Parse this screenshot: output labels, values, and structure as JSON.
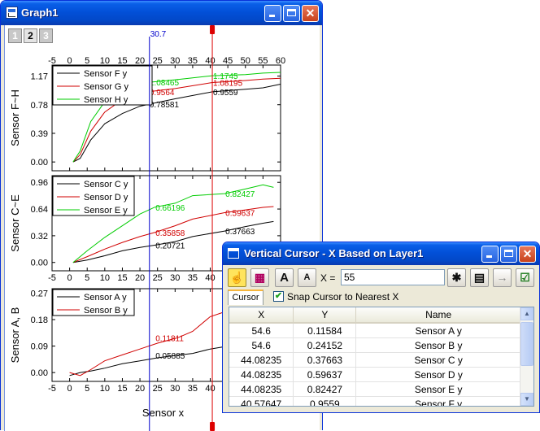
{
  "graph_window": {
    "title": "Graph1",
    "layer_tabs": [
      "1",
      "2",
      "3"
    ],
    "active_layer": "2",
    "cursor_top_label": "30.7"
  },
  "chart_data": [
    {
      "type": "line",
      "layer": "top",
      "ylabel": "Sensor F~H",
      "xlim": [
        -5,
        60
      ],
      "ylim": [
        -0.12,
        1.32
      ],
      "xticks": [
        -5,
        0,
        5,
        10,
        15,
        20,
        25,
        30,
        35,
        40,
        45,
        50,
        55,
        60
      ],
      "yticks": [
        0.0,
        0.39,
        0.78,
        1.17
      ],
      "ytick_labels": [
        "0.00",
        "0.39",
        "0.78",
        "1.17"
      ],
      "legend": "top-left",
      "series": [
        {
          "name": "Sensor F y",
          "color": "#000000",
          "x": [
            1,
            3,
            6,
            10,
            15,
            20,
            22.5,
            30,
            40.58,
            50,
            55,
            60
          ],
          "y": [
            0.0,
            0.05,
            0.3,
            0.52,
            0.66,
            0.76,
            0.78581,
            0.86,
            0.9559,
            0.99,
            1.01,
            1.06
          ]
        },
        {
          "name": "Sensor G y",
          "color": "#d00000",
          "x": [
            1,
            3,
            6,
            10,
            15,
            20,
            22.5,
            30,
            40.58,
            50,
            55,
            60
          ],
          "y": [
            0.0,
            0.1,
            0.42,
            0.68,
            0.85,
            0.93,
            0.9564,
            1.0,
            1.08195,
            1.11,
            1.13,
            1.14
          ]
        },
        {
          "name": "Sensor H y",
          "color": "#00cc00",
          "x": [
            1,
            3,
            6,
            10,
            15,
            20,
            22.5,
            30,
            40.58,
            50,
            55,
            60
          ],
          "y": [
            0.0,
            0.15,
            0.55,
            0.82,
            0.98,
            1.05,
            1.08465,
            1.12,
            1.1745,
            1.19,
            1.21,
            1.22
          ]
        }
      ],
      "annotations": [
        "0.78581",
        "0.9564",
        "1.08465",
        "0.9559",
        "1.08195",
        "1.1745"
      ]
    },
    {
      "type": "line",
      "layer": "middle",
      "ylabel": "Sensor C~E",
      "xlim": [
        -5,
        60
      ],
      "ylim": [
        -0.1,
        1.04
      ],
      "xticks": [
        -5,
        0,
        5,
        10,
        15,
        20,
        25,
        30,
        35,
        40,
        45,
        50,
        55,
        60
      ],
      "yticks": [
        0.0,
        0.32,
        0.64,
        0.96
      ],
      "ytick_labels": [
        "0.00",
        "0.32",
        "0.64",
        "0.96"
      ],
      "legend": "top-left",
      "series": [
        {
          "name": "Sensor C y",
          "color": "#000000",
          "x": [
            1,
            5,
            10,
            15,
            20,
            24.2,
            30,
            35,
            44.08,
            50,
            55,
            58
          ],
          "y": [
            0.0,
            0.03,
            0.08,
            0.14,
            0.18,
            0.20721,
            0.25,
            0.31,
            0.37663,
            0.43,
            0.47,
            0.49
          ]
        },
        {
          "name": "Sensor D y",
          "color": "#d00000",
          "x": [
            1,
            5,
            10,
            15,
            20,
            24.2,
            30,
            35,
            44.08,
            50,
            55,
            58
          ],
          "y": [
            0.0,
            0.07,
            0.16,
            0.24,
            0.31,
            0.35858,
            0.44,
            0.52,
            0.59637,
            0.63,
            0.66,
            0.67
          ]
        },
        {
          "name": "Sensor E y",
          "color": "#00cc00",
          "x": [
            1,
            5,
            10,
            15,
            20,
            24.2,
            30,
            35,
            44.08,
            50,
            55,
            58
          ],
          "y": [
            0.0,
            0.14,
            0.3,
            0.44,
            0.58,
            0.66196,
            0.71,
            0.8,
            0.82427,
            0.88,
            0.93,
            0.9
          ]
        }
      ],
      "annotations": [
        "0.20721",
        "0.35858",
        "0.66196",
        "0.37663",
        "0.59637",
        "0.82427"
      ]
    },
    {
      "type": "line",
      "layer": "bottom",
      "ylabel": "Sensor A, B",
      "xlabel": "Sensor x",
      "xlim": [
        -5,
        60
      ],
      "ylim": [
        -0.03,
        0.285
      ],
      "xticks": [
        -5,
        0,
        5,
        10,
        15,
        20,
        25,
        30,
        35,
        40,
        45,
        50,
        55,
        60
      ],
      "yticks": [
        0.0,
        0.09,
        0.18,
        0.27
      ],
      "ytick_labels": [
        "0.00",
        "0.09",
        "0.18",
        "0.27"
      ],
      "legend": "top-left",
      "series": [
        {
          "name": "Sensor A y",
          "color": "#000000",
          "x": [
            0,
            3,
            6,
            10,
            15,
            20,
            25,
            30.7,
            35,
            40,
            45,
            50,
            54.6
          ],
          "y": [
            -0.01,
            0.0,
            0.005,
            0.015,
            0.03,
            0.04,
            0.05,
            0.05885,
            0.065,
            0.08,
            0.09,
            0.1,
            0.11584
          ]
        },
        {
          "name": "Sensor B y",
          "color": "#d00000",
          "x": [
            0,
            3,
            6,
            10,
            15,
            20,
            25,
            30.7,
            35,
            40,
            45,
            50,
            54.6
          ],
          "y": [
            0.0,
            -0.01,
            0.01,
            0.04,
            0.06,
            0.08,
            0.1,
            0.11811,
            0.14,
            0.19,
            0.21,
            0.23,
            0.24152
          ]
        }
      ],
      "annotations": [
        "0.05885",
        "0.11811"
      ]
    }
  ],
  "vertical_cursor": {
    "title": "Vertical Cursor - X Based on Layer1",
    "x_label": "X =",
    "x_value": "55",
    "tab_label": "Cursor",
    "snap_label": "Snap Cursor to Nearest X",
    "snap_checked": true,
    "columns": [
      "X",
      "Y",
      "Name"
    ],
    "rows": [
      {
        "x": "54.6",
        "y": "0.11584",
        "name": "Sensor A y"
      },
      {
        "x": "54.6",
        "y": "0.24152",
        "name": "Sensor B y"
      },
      {
        "x": "44.08235",
        "y": "0.37663",
        "name": "Sensor C y"
      },
      {
        "x": "44.08235",
        "y": "0.59637",
        "name": "Sensor D y"
      },
      {
        "x": "44.08235",
        "y": "0.82427",
        "name": "Sensor E y"
      },
      {
        "x": "40.57647",
        "y": "0.9559",
        "name": "Sensor F y"
      }
    ]
  },
  "colors": {
    "titlebar": "#0250d8",
    "window_face": "#ece9d8",
    "cursor_blue": "#0000cc",
    "cursor_red": "#dd0000"
  }
}
